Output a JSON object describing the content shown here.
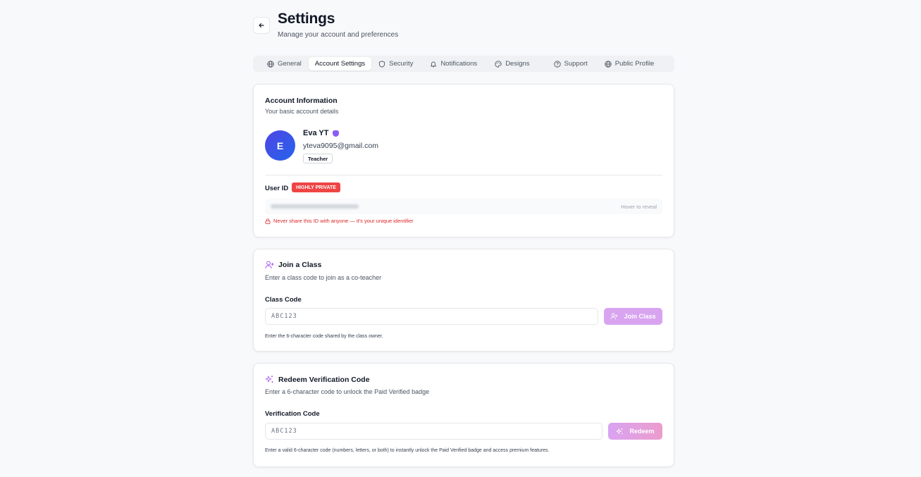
{
  "header": {
    "back_icon": "arrow-left-icon",
    "title": "Settings",
    "subtitle": "Manage your account and preferences"
  },
  "tabs": [
    {
      "label": "General",
      "icon": "globe-icon",
      "active": false
    },
    {
      "label": "Account Settings",
      "icon": "",
      "active": true
    },
    {
      "label": "Security",
      "icon": "shield-icon",
      "active": false
    },
    {
      "label": "Notifications",
      "icon": "bell-icon",
      "active": false
    },
    {
      "label": "Designs",
      "icon": "palette-icon",
      "active": false
    },
    {
      "label": "Support",
      "icon": "help-circle-icon",
      "active": false
    },
    {
      "label": "Public Profile",
      "icon": "globe-icon",
      "active": false
    }
  ],
  "account": {
    "title": "Account Information",
    "description": "Your basic account details",
    "avatar_initial": "E",
    "name": "Eva YT",
    "email": "yteva9095@gmail.com",
    "role": "Teacher",
    "user_id_label": "User ID",
    "private_badge": "HIGHLY PRIVATE",
    "hover_hint": "Hover to reveal",
    "warning": "Never share this ID with anyone — it's your unique identifier"
  },
  "join_class": {
    "title": "Join a Class",
    "description": "Enter a class code to join as a co-teacher",
    "field_label": "Class Code",
    "placeholder": "ABC123",
    "button_label": "Join Class",
    "hint": "Enter the 6-character code shared by the class owner."
  },
  "redeem": {
    "title": "Redeem Verification Code",
    "description": "Enter a 6-character code to unlock the Paid Verified badge",
    "field_label": "Verification Code",
    "placeholder": "ABC123",
    "button_label": "Redeem",
    "hint": "Enter a valid 6-character code (numbers, letters, or both) to instantly unlock the Paid Verified badge and access premium features."
  },
  "colors": {
    "accent_purple": "#8b5cf6",
    "danger": "#ef4444",
    "avatar": "#3b4fe0",
    "button_disabled": "#d8a4f0"
  }
}
